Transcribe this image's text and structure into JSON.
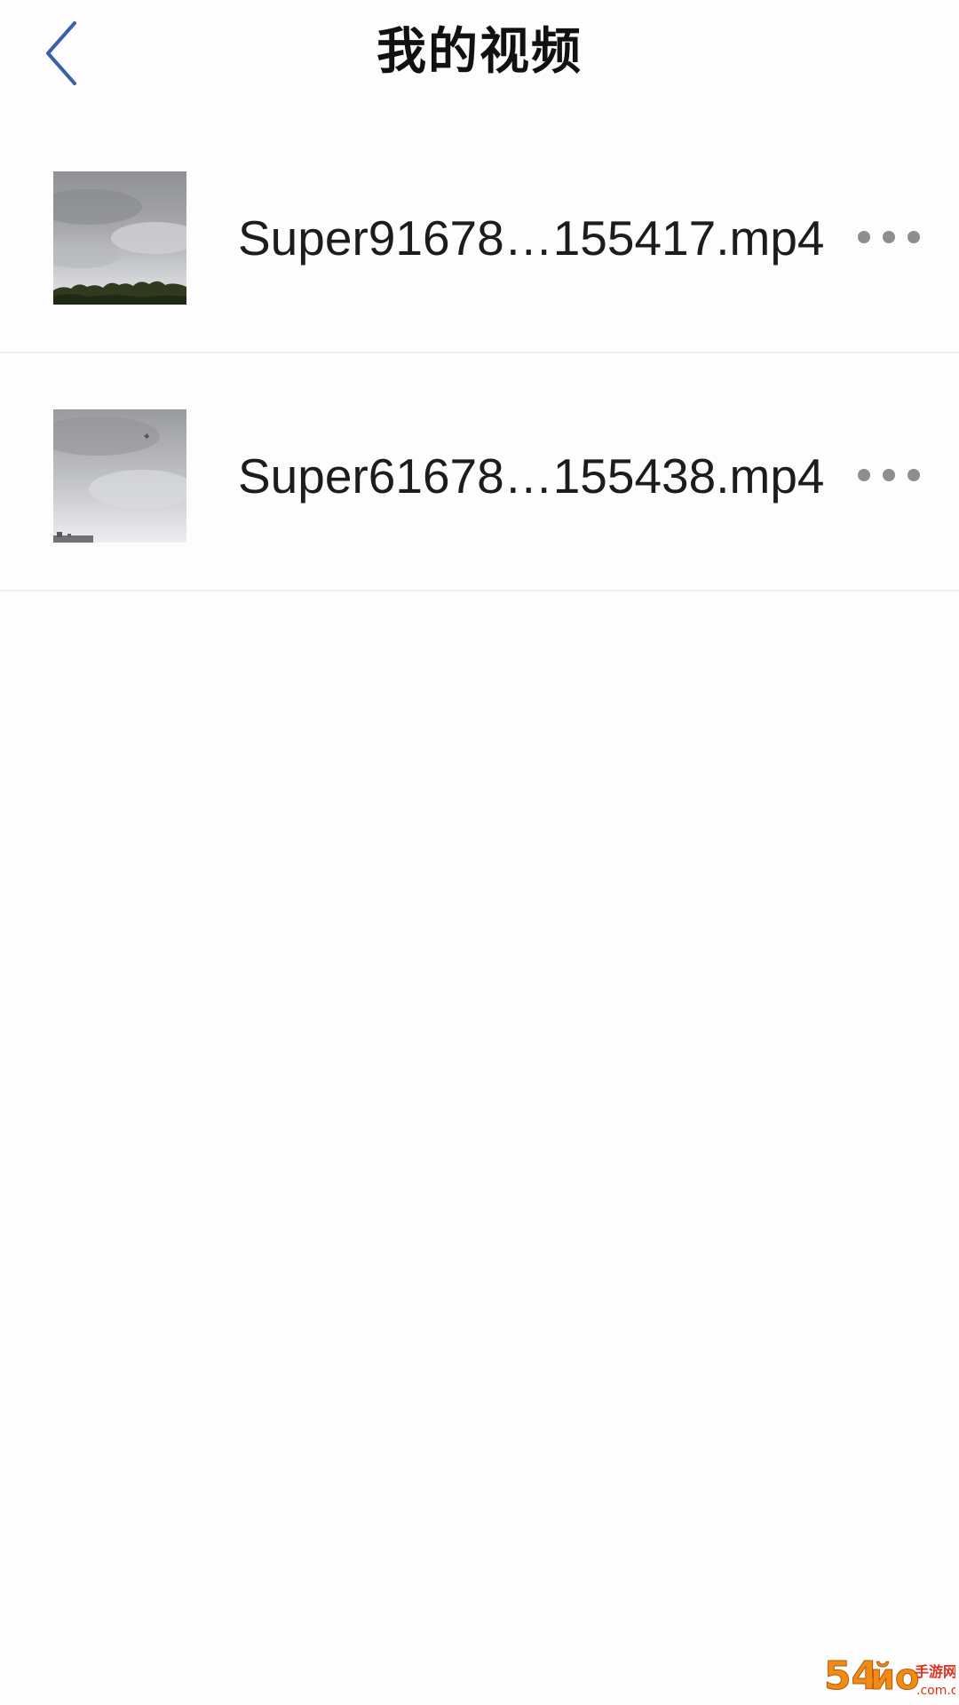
{
  "header": {
    "title": "我的视频",
    "back_icon": "chevron-left-icon"
  },
  "videos": [
    {
      "name": "Super91678…155417.mp4",
      "more_icon": "more-horizontal-icon"
    },
    {
      "name": "Super61678…155438.mp4",
      "more_icon": "more-horizontal-icon"
    }
  ],
  "watermark": {
    "logo_text": "54йo手游网",
    "domain_text": ".com.cn"
  },
  "colors": {
    "accent": "#3b5fa8",
    "background": "#fdfdfd",
    "divider": "#eeeeee",
    "more_dots": "#8e8e8e",
    "watermark_orange": "#f28a16"
  }
}
